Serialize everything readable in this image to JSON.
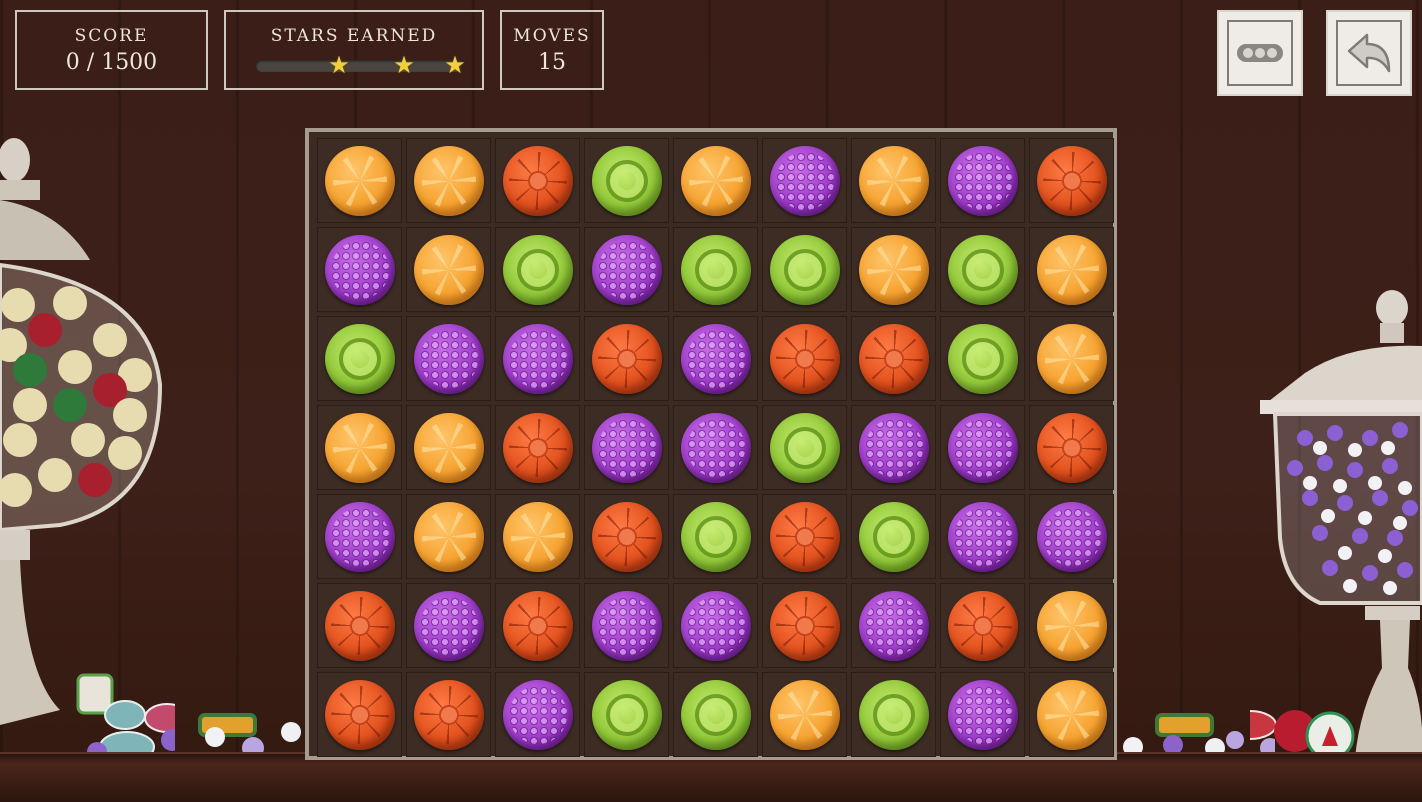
{
  "hud": {
    "score_label": "SCORE",
    "score_value": "0 / 1500",
    "stars_label": "STARS EARNED",
    "stars_progress": 0,
    "moves_label": "MOVES",
    "moves_value": "15"
  },
  "buttons": {
    "menu_icon": "more-dots-icon",
    "undo_icon": "undo-arrow-icon"
  },
  "colors": {
    "orange": "#f6a330",
    "red": "#e2521e",
    "green": "#93c93a",
    "purple": "#9b39c7"
  },
  "board": {
    "rows": [
      [
        "orange",
        "orange",
        "red",
        "green",
        "orange",
        "purple",
        "orange",
        "purple",
        "red"
      ],
      [
        "purple",
        "orange",
        "green",
        "purple",
        "green",
        "green",
        "orange",
        "green",
        "orange"
      ],
      [
        "green",
        "purple",
        "purple",
        "red",
        "purple",
        "red",
        "red",
        "green",
        "orange"
      ],
      [
        "orange",
        "orange",
        "red",
        "purple",
        "purple",
        "green",
        "purple",
        "purple",
        "red"
      ],
      [
        "purple",
        "orange",
        "orange",
        "red",
        "green",
        "red",
        "green",
        "purple",
        "purple"
      ],
      [
        "red",
        "purple",
        "red",
        "purple",
        "purple",
        "red",
        "purple",
        "red",
        "orange"
      ],
      [
        "red",
        "red",
        "purple",
        "green",
        "green",
        "orange",
        "green",
        "purple",
        "orange"
      ]
    ]
  }
}
